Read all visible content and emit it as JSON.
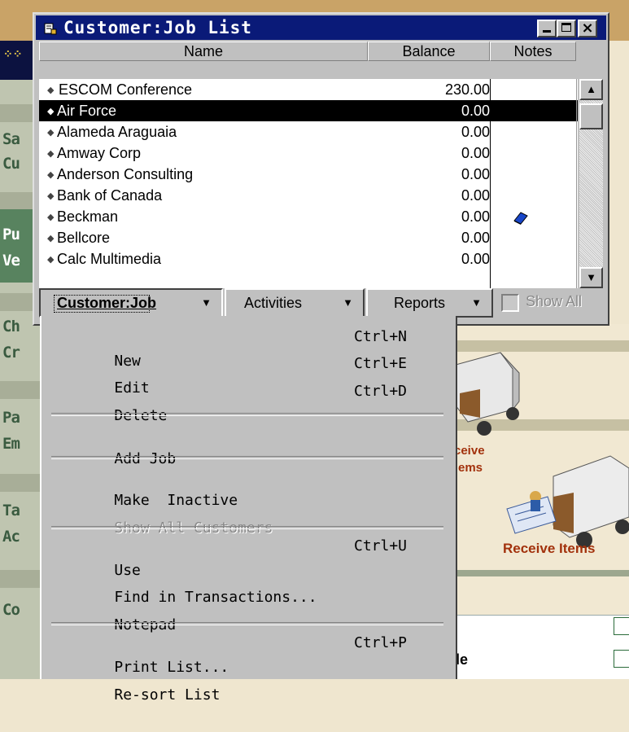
{
  "window": {
    "title": "Customer:Job List",
    "columns": [
      "Name",
      "Balance",
      "Notes"
    ],
    "rows": [
      {
        "name": "ESCOM Conference",
        "balance": "230.00",
        "selected": false,
        "has_note": false
      },
      {
        "name": "Air Force",
        "balance": "0.00",
        "selected": true,
        "has_note": false
      },
      {
        "name": "Alameda Araguaia",
        "balance": "0.00",
        "selected": false,
        "has_note": false
      },
      {
        "name": "Amway Corp",
        "balance": "0.00",
        "selected": false,
        "has_note": false
      },
      {
        "name": "Anderson Consulting",
        "balance": "0.00",
        "selected": false,
        "has_note": false
      },
      {
        "name": "Bank of Canada",
        "balance": "0.00",
        "selected": false,
        "has_note": false
      },
      {
        "name": "Beckman",
        "balance": "0.00",
        "selected": false,
        "has_note": true
      },
      {
        "name": "Bellcore",
        "balance": "0.00",
        "selected": false,
        "has_note": false
      },
      {
        "name": "Calc Multimedia",
        "balance": "0.00",
        "selected": false,
        "has_note": false
      }
    ],
    "buttons": {
      "customer_job": "Customer:Job",
      "activities": "Activities",
      "reports": "Reports"
    },
    "show_all": {
      "label": "Show All",
      "checked": false,
      "enabled": false
    }
  },
  "menu": {
    "groups": [
      [
        {
          "label": "New",
          "shortcut": "Ctrl+N",
          "enabled": true
        },
        {
          "label": "Edit",
          "shortcut": "Ctrl+E",
          "enabled": true
        },
        {
          "label": "Delete",
          "shortcut": "Ctrl+D",
          "enabled": true
        }
      ],
      [
        {
          "label": "Add Job",
          "shortcut": "",
          "enabled": true
        }
      ],
      [
        {
          "label": "Make  Inactive",
          "shortcut": "",
          "enabled": true
        },
        {
          "label": "Show All Customers",
          "shortcut": "",
          "enabled": false
        }
      ],
      [
        {
          "label": "Use",
          "shortcut": "Ctrl+U",
          "enabled": true
        },
        {
          "label": "Find in Transactions...",
          "shortcut": "",
          "enabled": true
        },
        {
          "label": "Notepad",
          "shortcut": "",
          "enabled": true
        }
      ],
      [
        {
          "label": "Print List...",
          "shortcut": "Ctrl+P",
          "enabled": true
        },
        {
          "label": "Re-sort List",
          "shortcut": "",
          "enabled": true
        }
      ]
    ]
  },
  "background": {
    "left_labels": [
      "Sa",
      "Cu",
      "Pu",
      "Ve",
      "Ch",
      "Cr",
      "Pa",
      "Em",
      "Ta",
      "Ac",
      "Co"
    ],
    "receive_partial": [
      "ceive",
      "ems"
    ],
    "receive_items": "Receive Items",
    "partial_text": "le"
  },
  "colors": {
    "titlebar": "#0a1a78",
    "selection": "#000000",
    "menu_bg": "#c0c0c0",
    "accent_orange": "#a2310c"
  }
}
